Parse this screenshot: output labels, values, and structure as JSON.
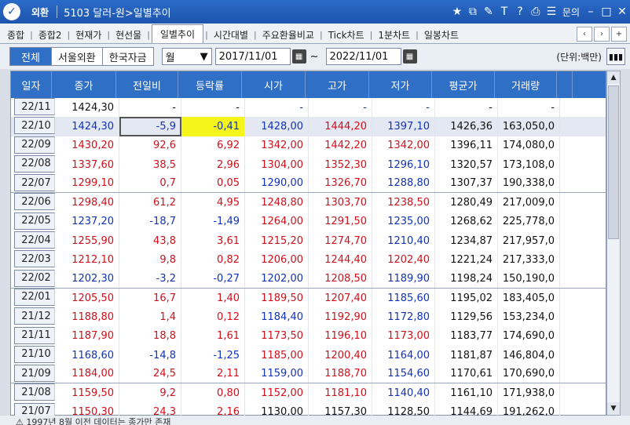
{
  "window": {
    "app_name": "외환",
    "title": "5103 달러-원>일별추이",
    "menu_label": "문의"
  },
  "tabs": [
    {
      "label": "종합"
    },
    {
      "label": "종합2"
    },
    {
      "label": "현재가"
    },
    {
      "label": "현선물"
    },
    {
      "label": "일별추이"
    },
    {
      "label": "시간대별"
    },
    {
      "label": "주요환율비교"
    },
    {
      "label": "Tick차트"
    },
    {
      "label": "1분차트"
    },
    {
      "label": "일봉차트"
    }
  ],
  "toolbar": {
    "filters": [
      "전체",
      "서울외환",
      "한국자금"
    ],
    "period_select": "월",
    "start_date": "2017/11/01",
    "end_date": "2022/11/01",
    "unit_label": "(단위:백만)"
  },
  "columns": [
    "일자",
    "종가",
    "전일비",
    "등락률",
    "시가",
    "고가",
    "저가",
    "평균가",
    "거래량"
  ],
  "rows": [
    {
      "date": "22/11",
      "close": "1424,30",
      "change": "-",
      "rate": "-",
      "open": "-",
      "high": "-",
      "low": "-",
      "avg": "-",
      "volume": "-"
    },
    {
      "date": "22/10",
      "close": "1424,30",
      "change": "-5,9",
      "rate": "-0,41",
      "open": "1428,00",
      "high": "1444,20",
      "low": "1397,10",
      "avg": "1426,36",
      "volume": "163,050,0"
    },
    {
      "date": "22/09",
      "close": "1430,20",
      "change": "92,6",
      "rate": "6,92",
      "open": "1342,00",
      "high": "1442,20",
      "low": "1342,00",
      "avg": "1396,11",
      "volume": "174,080,0"
    },
    {
      "date": "22/08",
      "close": "1337,60",
      "change": "38,5",
      "rate": "2,96",
      "open": "1304,00",
      "high": "1352,30",
      "low": "1296,10",
      "avg": "1320,57",
      "volume": "173,108,0"
    },
    {
      "date": "22/07",
      "close": "1299,10",
      "change": "0,7",
      "rate": "0,05",
      "open": "1290,00",
      "high": "1326,70",
      "low": "1288,80",
      "avg": "1307,37",
      "volume": "190,338,0"
    },
    {
      "date": "22/06",
      "close": "1298,40",
      "change": "61,2",
      "rate": "4,95",
      "open": "1248,80",
      "high": "1303,70",
      "low": "1238,50",
      "avg": "1280,49",
      "volume": "217,009,0"
    },
    {
      "date": "22/05",
      "close": "1237,20",
      "change": "-18,7",
      "rate": "-1,49",
      "open": "1264,00",
      "high": "1291,50",
      "low": "1235,00",
      "avg": "1268,62",
      "volume": "225,778,0"
    },
    {
      "date": "22/04",
      "close": "1255,90",
      "change": "43,8",
      "rate": "3,61",
      "open": "1215,20",
      "high": "1274,70",
      "low": "1210,40",
      "avg": "1234,87",
      "volume": "217,957,0"
    },
    {
      "date": "22/03",
      "close": "1212,10",
      "change": "9,8",
      "rate": "0,82",
      "open": "1206,00",
      "high": "1244,40",
      "low": "1202,40",
      "avg": "1221,24",
      "volume": "217,333,0"
    },
    {
      "date": "22/02",
      "close": "1202,30",
      "change": "-3,2",
      "rate": "-0,27",
      "open": "1202,00",
      "high": "1208,50",
      "low": "1189,90",
      "avg": "1198,24",
      "volume": "150,190,0"
    },
    {
      "date": "22/01",
      "close": "1205,50",
      "change": "16,7",
      "rate": "1,40",
      "open": "1189,50",
      "high": "1207,40",
      "low": "1185,60",
      "avg": "1195,02",
      "volume": "183,405,0"
    },
    {
      "date": "21/12",
      "close": "1188,80",
      "change": "1,4",
      "rate": "0,12",
      "open": "1184,40",
      "high": "1192,90",
      "low": "1172,80",
      "avg": "1129,56",
      "volume": "153,234,0"
    },
    {
      "date": "21/11",
      "close": "1187,90",
      "change": "18,8",
      "rate": "1,61",
      "open": "1173,50",
      "high": "1196,10",
      "low": "1173,00",
      "avg": "1183,77",
      "volume": "174,690,0"
    },
    {
      "date": "21/10",
      "close": "1168,60",
      "change": "-14,8",
      "rate": "-1,25",
      "open": "1185,00",
      "high": "1200,40",
      "low": "1164,00",
      "avg": "1181,87",
      "volume": "146,804,0"
    },
    {
      "date": "21/09",
      "close": "1184,00",
      "change": "24,5",
      "rate": "2,11",
      "open": "1159,00",
      "high": "1188,70",
      "low": "1154,60",
      "avg": "1170,61",
      "volume": "170,690,0"
    },
    {
      "date": "21/08",
      "close": "1159,50",
      "change": "9,2",
      "rate": "0,80",
      "open": "1152,00",
      "high": "1181,10",
      "low": "1140,40",
      "avg": "1161,10",
      "volume": "171,938,0"
    },
    {
      "date": "21/07",
      "close": "1150,30",
      "change": "24,3",
      "rate": "2,16",
      "open": "1130,00",
      "high": "1157,30",
      "low": "1128,50",
      "avg": "1144,69",
      "volume": "191,262,0"
    }
  ],
  "footer_note": "1997년 8월 이전 데이터는 종가만 존재",
  "colors": {
    "up": "#d0101b",
    "down": "#1232b8",
    "header": "#2f6fc5",
    "highlight": "#f5f51c"
  }
}
